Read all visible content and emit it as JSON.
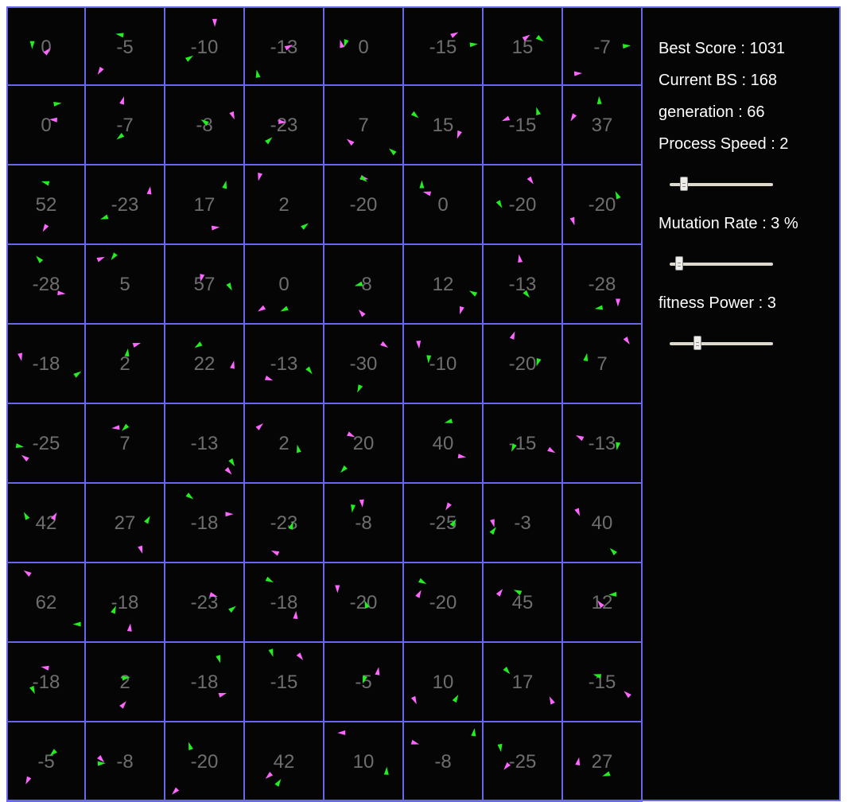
{
  "colors": {
    "grid_line": "#6868ee",
    "score_text": "#6e6e6e",
    "agent_a": "#ff66ff",
    "agent_b": "#22ee22"
  },
  "icons": {
    "agent_a": "magenta-triangle-agent-icon",
    "agent_b": "green-triangle-agent-icon"
  },
  "scores": [
    [
      "0",
      "-5",
      "-10",
      "-13",
      "0",
      "-15",
      "15",
      "-7"
    ],
    [
      "0",
      "-7",
      "-8",
      "-23",
      "7",
      "15",
      "-15",
      "37"
    ],
    [
      "52",
      "-23",
      "17",
      "2",
      "-20",
      "0",
      "-20",
      "-20"
    ],
    [
      "-28",
      "5",
      "57",
      "0",
      "-8",
      "12",
      "-13",
      "-28"
    ],
    [
      "-18",
      "2",
      "22",
      "-13",
      "-30",
      "-10",
      "-20",
      "7"
    ],
    [
      "-25",
      "7",
      "-13",
      "2",
      "20",
      "40",
      "-15",
      "-13"
    ],
    [
      "42",
      "27",
      "-18",
      "-23",
      "-8",
      "-25",
      "-3",
      "40"
    ],
    [
      "62",
      "-18",
      "-23",
      "-18",
      "-20",
      "-20",
      "45",
      "12"
    ],
    [
      "-18",
      "2",
      "-18",
      "-15",
      "-5",
      "10",
      "17",
      "-15"
    ],
    [
      "-5",
      "-8",
      "-20",
      "42",
      "10",
      "-8",
      "-25",
      "27"
    ]
  ],
  "panel": {
    "best_score": "Best Score : 1031",
    "current_bs": "Current BS : 168",
    "generation": "generation : 66",
    "process_speed": "Process Speed : 2",
    "mutation_rate": "Mutation Rate  : 3 %",
    "fitness_power": "fitness Power  : 3"
  },
  "sliders": {
    "process_speed_level": 0.11,
    "mutation_rate_level": 0.06,
    "fitness_power_level": 0.25
  }
}
